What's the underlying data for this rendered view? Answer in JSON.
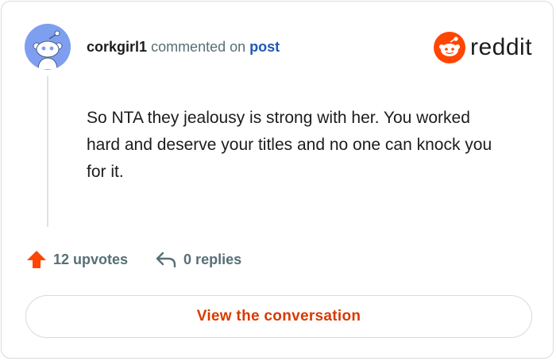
{
  "comment": {
    "username": "corkgirl1",
    "action_text": "commented on",
    "target_link": "post",
    "body": "So NTA they jealousy is strong with her. You worked hard and deserve your titles and no one can knock you for it."
  },
  "brand": {
    "name": "reddit",
    "color": "#ff4500"
  },
  "stats": {
    "upvotes": "12 upvotes",
    "replies": "0 replies"
  },
  "cta": {
    "label": "View the conversation",
    "color": "#d93900"
  },
  "icons": {
    "avatar": "snoo-avatar-icon",
    "logo": "reddit-logo-icon",
    "upvote": "upvote-arrow-icon",
    "reply": "reply-arrow-icon"
  }
}
